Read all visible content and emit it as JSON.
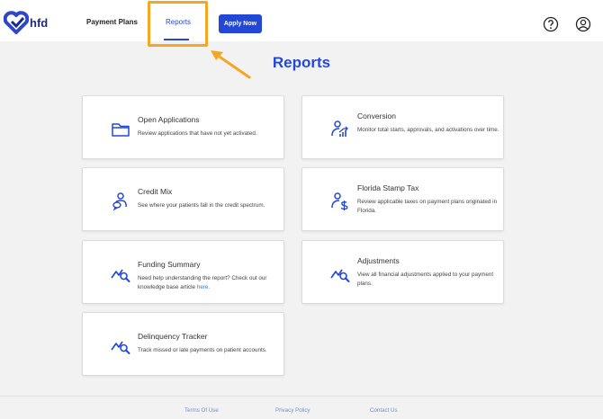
{
  "header": {
    "logo_text": "hfd",
    "nav": {
      "payment_plans": "Payment Plans",
      "reports": "Reports"
    },
    "apply_button": "Apply Now",
    "help_icon": "question-circle-icon",
    "user_icon": "user-circle-icon"
  },
  "main": {
    "title": "Reports",
    "cards": [
      {
        "title": "Open Applications",
        "description": "Review applications that have not yet activated.",
        "icon": "folder-icon"
      },
      {
        "title": "Conversion",
        "description": "Monitor total starts, approvals, and activations over time.",
        "icon": "person-chart-icon"
      },
      {
        "title": "Credit Mix",
        "description": "See where your patients fall in the credit spectrum.",
        "icon": "person-chat-icon"
      },
      {
        "title": "Florida Stamp Tax",
        "description": "Review applicable taxes on payment plans originated in Florida.",
        "icon": "person-dollar-icon"
      },
      {
        "title": "Funding Summary",
        "description": "Need help understanding the report? Check out our knowledge base article ",
        "link_text": "here.",
        "icon": "chart-search-icon"
      },
      {
        "title": "Adjustments",
        "description": "View all financial adjustments applied to your payment plans.",
        "icon": "chart-search-icon"
      },
      {
        "title": "Delinquency Tracker",
        "description": "Track missed or late payments on patient accounts.",
        "icon": "chart-search-icon"
      }
    ]
  },
  "footer": {
    "terms": "Terms Of Use",
    "privacy": "Privacy Policy",
    "contact": "Contact Us"
  },
  "colors": {
    "brand": "#2448d6",
    "highlight": "#f5a623",
    "link": "#2a7de1"
  }
}
